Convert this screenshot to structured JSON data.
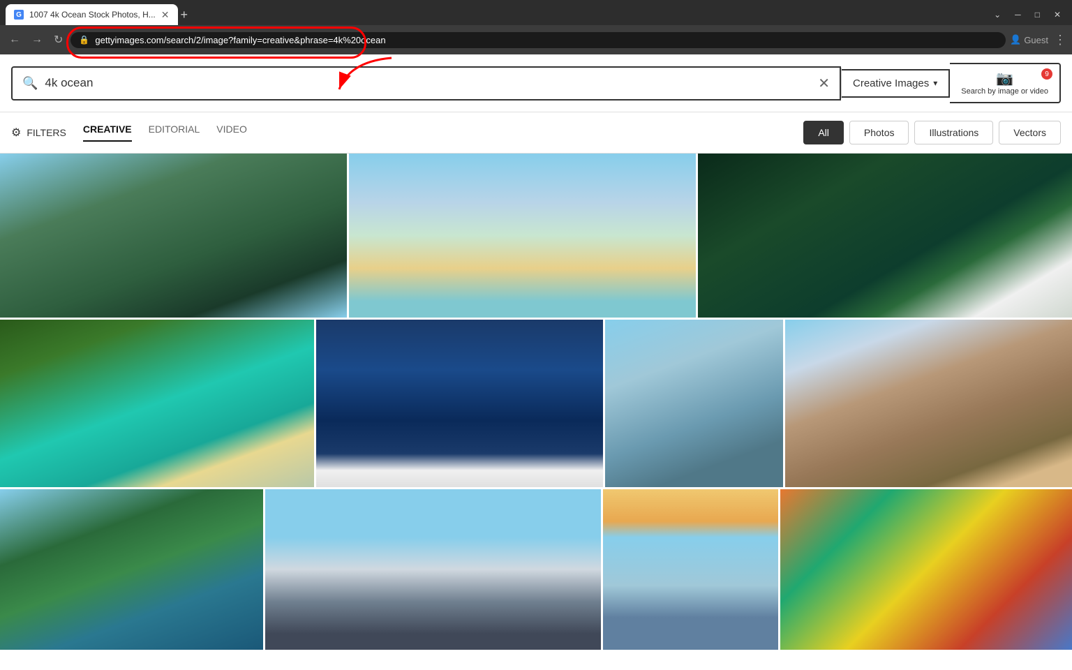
{
  "browser": {
    "tab_title": "1007 4k Ocean Stock Photos, H...",
    "new_tab_label": "+",
    "back_label": "←",
    "forward_label": "→",
    "refresh_label": "↻",
    "url": "gettyimages.com/search/2/image?family=creative&phrase=4k%20ocean",
    "profile_label": "Guest",
    "minimize_label": "─",
    "maximize_label": "□",
    "close_label": "✕",
    "more_label": "⋮"
  },
  "search": {
    "query": "4k ocean",
    "clear_label": "✕",
    "type_label": "Creative Images",
    "type_arrow": "▾",
    "image_search_label": "Search by image\nor video",
    "badge_count": "9"
  },
  "filter_bar": {
    "filters_label": "FILTERS",
    "tabs": [
      {
        "id": "creative",
        "label": "CREATIVE",
        "active": true
      },
      {
        "id": "editorial",
        "label": "EDITORIAL",
        "active": false
      },
      {
        "id": "video",
        "label": "VIDEO",
        "active": false
      }
    ],
    "type_buttons": [
      {
        "id": "all",
        "label": "All",
        "active": true
      },
      {
        "id": "photos",
        "label": "Photos",
        "active": false
      },
      {
        "id": "illustrations",
        "label": "Illustrations",
        "active": false
      },
      {
        "id": "vectors",
        "label": "Vectors",
        "active": false
      }
    ]
  },
  "images": {
    "row1": [
      {
        "id": "aerial-islands",
        "style": "aerial-islands",
        "flex": "2.5"
      },
      {
        "id": "palm-island",
        "style": "palm-island",
        "flex": "2.5"
      },
      {
        "id": "ocean-waves",
        "style": "ocean-waves",
        "flex": "2.7"
      }
    ],
    "row2": [
      {
        "id": "coastal-road",
        "style": "coastal-road",
        "flex": "2.3"
      },
      {
        "id": "sailboat",
        "style": "sailboat",
        "flex": "2.1"
      },
      {
        "id": "birds-ocean",
        "style": "birds-ocean",
        "flex": "1.3"
      },
      {
        "id": "mountains",
        "style": "mountains",
        "flex": "2.1"
      }
    ],
    "row3": [
      {
        "id": "coastal2",
        "style": "coastal2",
        "flex": "1.8"
      },
      {
        "id": "ship",
        "style": "ship",
        "flex": "2.3"
      },
      {
        "id": "lighthouse",
        "style": "lighthouse",
        "flex": "1.2"
      },
      {
        "id": "colorful-map",
        "style": "colorful-map",
        "flex": "2.0"
      }
    ]
  }
}
